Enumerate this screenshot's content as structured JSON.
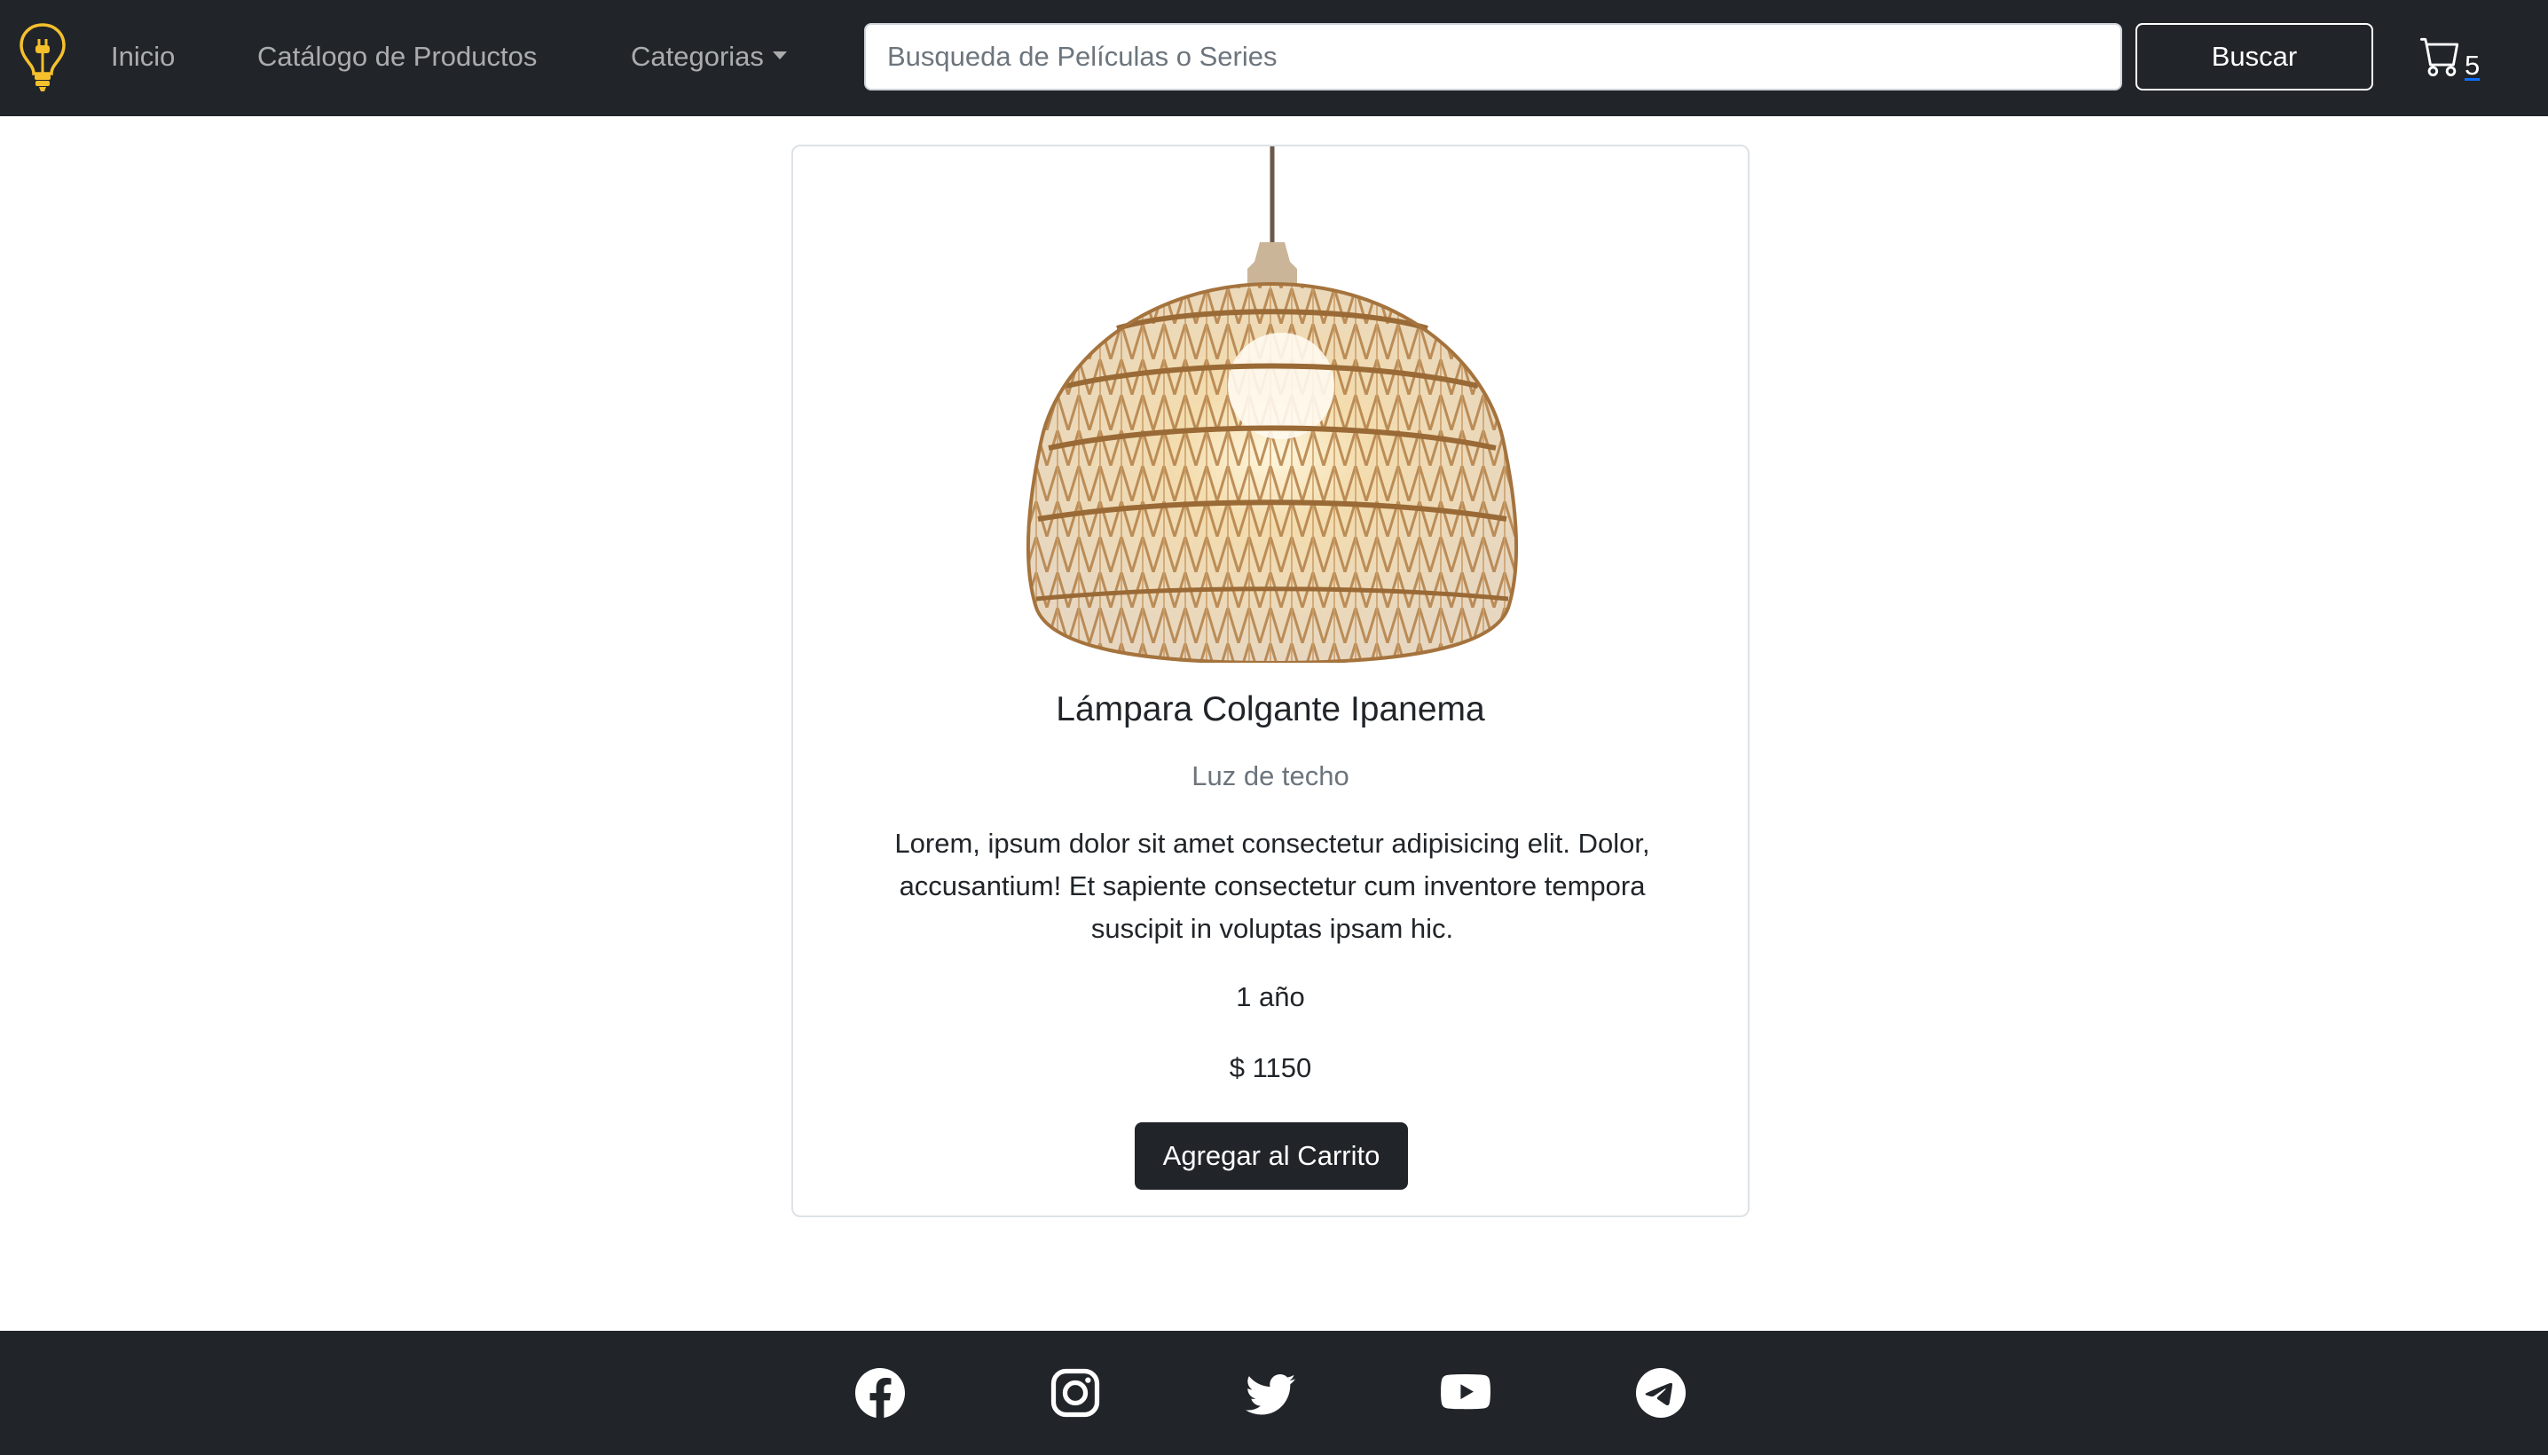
{
  "navbar": {
    "links": {
      "inicio": "Inicio",
      "catalogo": "Catálogo de Productos",
      "categorias": "Categorias"
    },
    "search": {
      "placeholder": "Busqueda de Películas o Series",
      "value": "",
      "button_label": "Buscar"
    },
    "cart": {
      "count": "5",
      "icon": "cart-icon"
    },
    "logo_icon": "lightbulb-plug-icon"
  },
  "product": {
    "title": "Lámpara Colgante Ipanema",
    "subtitle": "Luz de techo",
    "description": "Lorem, ipsum dolor sit amet consectetur adipisicing elit. Dolor, accusantium! Et sapiente consectetur cum inventore tempora suscipit in voluptas ipsam hic.",
    "duration": "1 año",
    "price": "$ 1150",
    "add_button_label": "Agregar al Carrito"
  },
  "footer": {
    "social_icons": [
      "facebook-icon",
      "instagram-icon",
      "twitter-icon",
      "youtube-icon",
      "telegram-icon"
    ]
  },
  "colors": {
    "navbar_bg": "#212529",
    "accent_yellow": "#f5c02c",
    "text_muted": "#6c757d"
  }
}
